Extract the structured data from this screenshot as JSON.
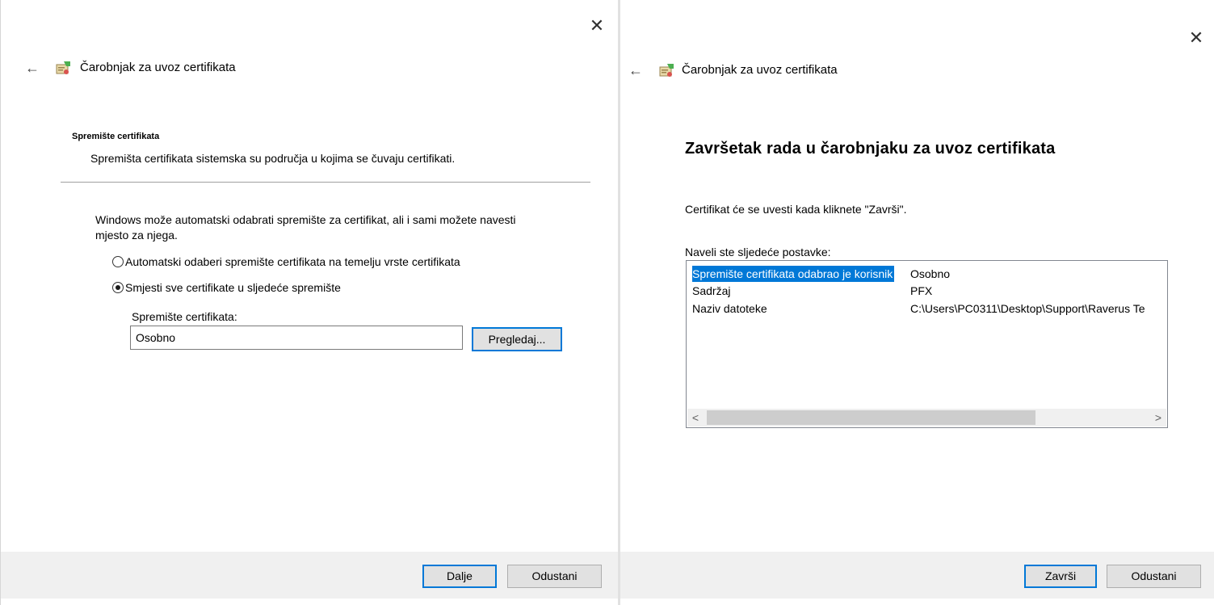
{
  "wizard_title": "Čarobnjak za uvoz certifikata",
  "left": {
    "section_heading": "Spremište certifikata",
    "section_desc": "Spremišta certifikata sistemska su područja u kojima se čuvaju certifikati.",
    "intro_line1": "Windows može automatski odabrati spremište za certifikat, ali i sami možete navesti",
    "intro_line2": "mjesto za njega.",
    "radio_auto_label": "Automatski odaberi spremište certifikata na temelju vrste certifikata",
    "radio_manual_label": "Smjesti sve certifikate u sljedeće spremište",
    "radio_selected": "manual",
    "store_label": "Spremište certifikata:",
    "store_value": "Osobno",
    "browse_label": "Pregledaj...",
    "next_label": "Dalje",
    "cancel_label": "Odustani"
  },
  "right": {
    "heading": "Završetak rada u čarobnjaku za uvoz certifikata",
    "info_text": "Certifikat će se uvesti kada kliknete \"Završi\".",
    "settings_label": "Naveli ste sljedeće postavke:",
    "settings": [
      {
        "key": "Spremište certifikata odabrao je korisnik",
        "value": "Osobno"
      },
      {
        "key": "Sadržaj",
        "value": "PFX"
      },
      {
        "key": "Naziv datoteke",
        "value": "C:\\Users\\PC0311\\Desktop\\Support\\Raverus Te"
      }
    ],
    "finish_label": "Završi",
    "cancel_label": "Odustani"
  },
  "icons": {
    "close": "close-icon",
    "back": "back-arrow-icon",
    "wizard": "certificate-wizard-icon"
  },
  "colors": {
    "accent": "#0078d7",
    "footer_bg": "#f0f0f0",
    "button_bg": "#e1e1e1"
  }
}
